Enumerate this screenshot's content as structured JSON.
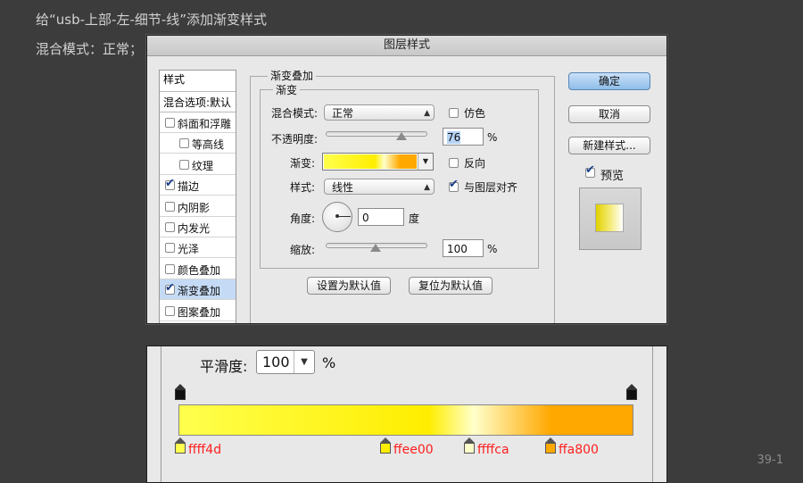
{
  "caption_line1": "给“usb-上部-左-细节-线”添加渐变样式",
  "caption_line2": "混合模式：正常；",
  "page_number": "39-1",
  "dialog": {
    "title": "图层样式",
    "styles_header": "样式",
    "blend_default": "混合选项:默认",
    "style_items": [
      {
        "label": "斜面和浮雕",
        "checked": false,
        "indent": false
      },
      {
        "label": "等高线",
        "checked": false,
        "indent": true
      },
      {
        "label": "纹理",
        "checked": false,
        "indent": true
      },
      {
        "label": "描边",
        "checked": true,
        "indent": false
      },
      {
        "label": "内阴影",
        "checked": false,
        "indent": false
      },
      {
        "label": "内发光",
        "checked": false,
        "indent": false
      },
      {
        "label": "光泽",
        "checked": false,
        "indent": false
      },
      {
        "label": "颜色叠加",
        "checked": false,
        "indent": false
      },
      {
        "label": "渐变叠加",
        "checked": true,
        "indent": false,
        "selected": true
      },
      {
        "label": "图案叠加",
        "checked": false,
        "indent": false
      }
    ],
    "group_outer": "渐变叠加",
    "group_inner": "渐变",
    "blend_mode_label": "混合模式:",
    "blend_mode_value": "正常",
    "dither_label": "仿色",
    "dither_checked": false,
    "opacity_label": "不透明度:",
    "opacity_value": "76",
    "opacity_unit": "%",
    "gradient_label": "渐变:",
    "reverse_label": "反向",
    "reverse_checked": false,
    "style_label": "样式:",
    "style_value": "线性",
    "align_label": "与图层对齐",
    "align_checked": true,
    "angle_label": "角度:",
    "angle_value": "0",
    "angle_unit": "度",
    "scale_label": "缩放:",
    "scale_value": "100",
    "scale_unit": "%",
    "set_default_label": "设置为默认值",
    "reset_default_label": "复位为默认值",
    "ok_label": "确定",
    "cancel_label": "取消",
    "new_style_label": "新建样式...",
    "preview_label": "预览",
    "preview_checked": true
  },
  "gradient_editor": {
    "smoothness_label": "平滑度:",
    "smoothness_value": "100",
    "smoothness_unit": "%",
    "stops": [
      {
        "label": "ffff4d",
        "color": "#ffff4d"
      },
      {
        "label": "ffee00",
        "color": "#ffee00"
      },
      {
        "label": "ffffca",
        "color": "#ffffca"
      },
      {
        "label": "ffa800",
        "color": "#ffa800"
      }
    ]
  },
  "colors": {
    "gradient_css": "linear-gradient(to right,#ffff4d 0%,#ffee00 55%,#ffffca 65%,#ffa800 82%,#ffa800 100%)"
  }
}
